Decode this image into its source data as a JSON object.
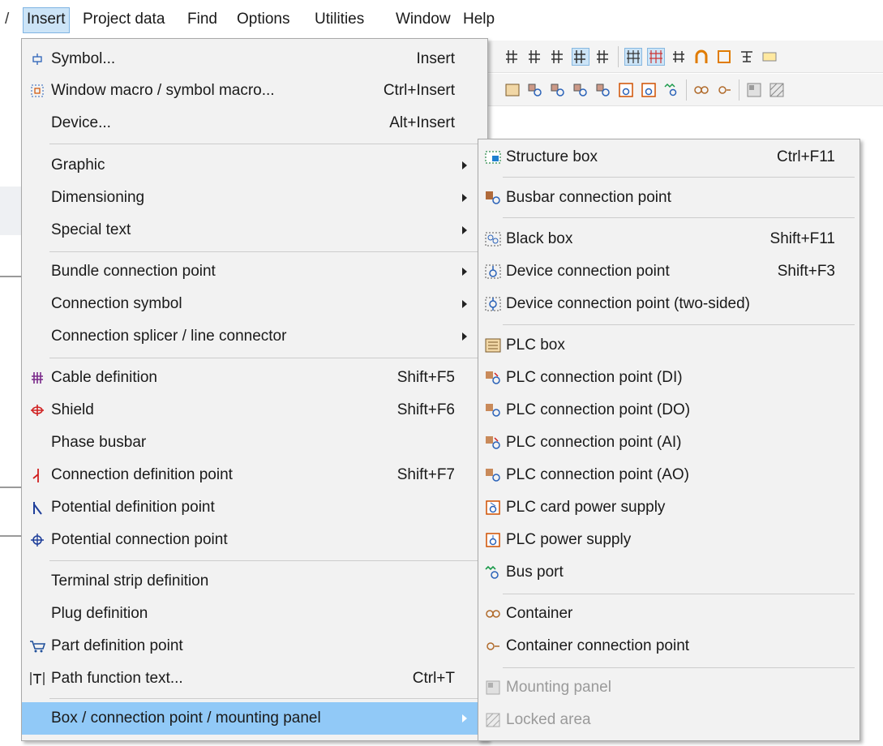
{
  "menubar": {
    "lead": "/",
    "items": [
      "Insert",
      "Project data",
      "Find",
      "Options",
      "Utilities",
      "Window",
      "Help"
    ]
  },
  "main_menu": {
    "items": [
      {
        "icon": "symbol-icon",
        "label": "Symbol...",
        "shortcut": "Insert"
      },
      {
        "icon": "window-macro-icon",
        "label": "Window macro / symbol macro...",
        "shortcut": "Ctrl+Insert"
      },
      {
        "icon": "",
        "label": "Device...",
        "shortcut": "Alt+Insert"
      },
      {
        "icon": "",
        "label": "Graphic",
        "shortcut": "",
        "submenu": true
      },
      {
        "icon": "",
        "label": "Dimensioning",
        "shortcut": "",
        "submenu": true
      },
      {
        "icon": "",
        "label": "Special text",
        "shortcut": "",
        "submenu": true
      },
      {
        "icon": "",
        "label": "Bundle connection point",
        "shortcut": "",
        "submenu": true
      },
      {
        "icon": "",
        "label": "Connection symbol",
        "shortcut": "",
        "submenu": true
      },
      {
        "icon": "",
        "label": "Connection splicer / line connector",
        "shortcut": "",
        "submenu": true
      },
      {
        "icon": "cable-definition-icon",
        "label": "Cable definition",
        "shortcut": "Shift+F5"
      },
      {
        "icon": "shield-icon",
        "label": "Shield",
        "shortcut": "Shift+F6"
      },
      {
        "icon": "",
        "label": "Phase busbar",
        "shortcut": ""
      },
      {
        "icon": "connection-definition-point-icon",
        "label": "Connection definition point",
        "shortcut": "Shift+F7"
      },
      {
        "icon": "potential-definition-point-icon",
        "label": "Potential definition point",
        "shortcut": ""
      },
      {
        "icon": "potential-connection-point-icon",
        "label": "Potential connection point",
        "shortcut": ""
      },
      {
        "icon": "",
        "label": "Terminal strip definition",
        "shortcut": ""
      },
      {
        "icon": "",
        "label": "Plug definition",
        "shortcut": ""
      },
      {
        "icon": "part-definition-point-icon",
        "label": "Part definition point",
        "shortcut": ""
      },
      {
        "icon": "path-function-text-icon",
        "label": "Path function text...",
        "shortcut": "Ctrl+T"
      },
      {
        "icon": "",
        "label": "Box / connection point / mounting panel",
        "shortcut": "",
        "submenu": true,
        "highlighted": true
      }
    ]
  },
  "sub_menu": {
    "items": [
      {
        "icon": "structure-box-icon",
        "label": "Structure box",
        "shortcut": "Ctrl+F11"
      },
      {
        "icon": "busbar-connection-point-icon",
        "label": "Busbar connection point",
        "shortcut": ""
      },
      {
        "icon": "black-box-icon",
        "label": "Black box",
        "shortcut": "Shift+F11"
      },
      {
        "icon": "device-connection-point-icon",
        "label": "Device connection point",
        "shortcut": "Shift+F3"
      },
      {
        "icon": "device-connection-point-two-sided-icon",
        "label": "Device connection point (two-sided)",
        "shortcut": ""
      },
      {
        "icon": "plc-box-icon",
        "label": "PLC box",
        "shortcut": ""
      },
      {
        "icon": "plc-connection-point-di-icon",
        "label": "PLC connection point (DI)",
        "shortcut": ""
      },
      {
        "icon": "plc-connection-point-do-icon",
        "label": "PLC connection point (DO)",
        "shortcut": ""
      },
      {
        "icon": "plc-connection-point-ai-icon",
        "label": "PLC connection point (AI)",
        "shortcut": ""
      },
      {
        "icon": "plc-connection-point-ao-icon",
        "label": "PLC connection point (AO)",
        "shortcut": ""
      },
      {
        "icon": "plc-card-power-supply-icon",
        "label": "PLC card power supply",
        "shortcut": ""
      },
      {
        "icon": "plc-power-supply-icon",
        "label": "PLC power supply",
        "shortcut": ""
      },
      {
        "icon": "bus-port-icon",
        "label": "Bus port",
        "shortcut": ""
      },
      {
        "icon": "container-icon",
        "label": "Container",
        "shortcut": ""
      },
      {
        "icon": "container-connection-point-icon",
        "label": "Container connection point",
        "shortcut": ""
      },
      {
        "icon": "mounting-panel-icon",
        "label": "Mounting panel",
        "shortcut": "",
        "disabled": true
      },
      {
        "icon": "locked-area-icon",
        "label": "Locked area",
        "shortcut": "",
        "disabled": true
      }
    ]
  },
  "colors": {
    "menu_bg": "#f2f2f2",
    "highlight": "#91c9f7",
    "active_menubar": "#cce4f7",
    "disabled_text": "#9a9a9a"
  }
}
